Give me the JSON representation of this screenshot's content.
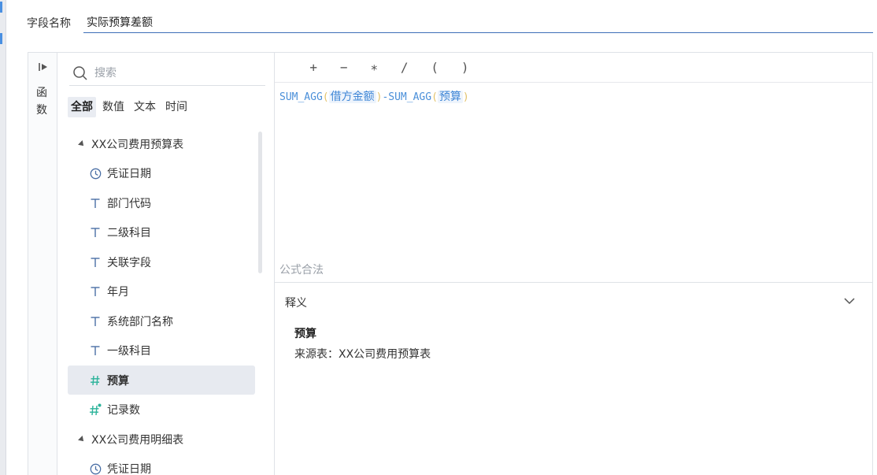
{
  "field_name": {
    "label": "字段名称",
    "value": "实际预算差额"
  },
  "functions_rail": {
    "label": "函数"
  },
  "search": {
    "placeholder": "搜索"
  },
  "filters": [
    "全部",
    "数值",
    "文本",
    "时间"
  ],
  "tree": [
    {
      "kind": "group",
      "label": "XX公司费用预算表"
    },
    {
      "kind": "field",
      "type": "date",
      "label": "凭证日期"
    },
    {
      "kind": "field",
      "type": "text",
      "label": "部门代码"
    },
    {
      "kind": "field",
      "type": "text",
      "label": "二级科目"
    },
    {
      "kind": "field",
      "type": "text",
      "label": "关联字段"
    },
    {
      "kind": "field",
      "type": "text",
      "label": "年月"
    },
    {
      "kind": "field",
      "type": "text",
      "label": "系统部门名称"
    },
    {
      "kind": "field",
      "type": "text",
      "label": "一级科目"
    },
    {
      "kind": "field",
      "type": "number",
      "label": "预算",
      "selected": true
    },
    {
      "kind": "field",
      "type": "count",
      "label": "记录数"
    },
    {
      "kind": "group",
      "label": "XX公司费用明细表"
    },
    {
      "kind": "field",
      "type": "date",
      "label": "凭证日期"
    }
  ],
  "operators": [
    "+",
    "−",
    "∗",
    "/",
    "(",
    ")"
  ],
  "formula": {
    "func1": "SUM_AGG",
    "open": "(",
    "arg1": "借方金额",
    "close": ")",
    "minus": "-",
    "func2": "SUM_AGG",
    "arg2": "预算"
  },
  "status": "公式合法",
  "definition": {
    "title": "释义",
    "field": "预算",
    "source": "来源表：XX公司费用预算表"
  },
  "colors": {
    "accent": "#4a8fd9",
    "number_icon": "#2bb39a",
    "selected_bg": "#e7eaf0"
  }
}
